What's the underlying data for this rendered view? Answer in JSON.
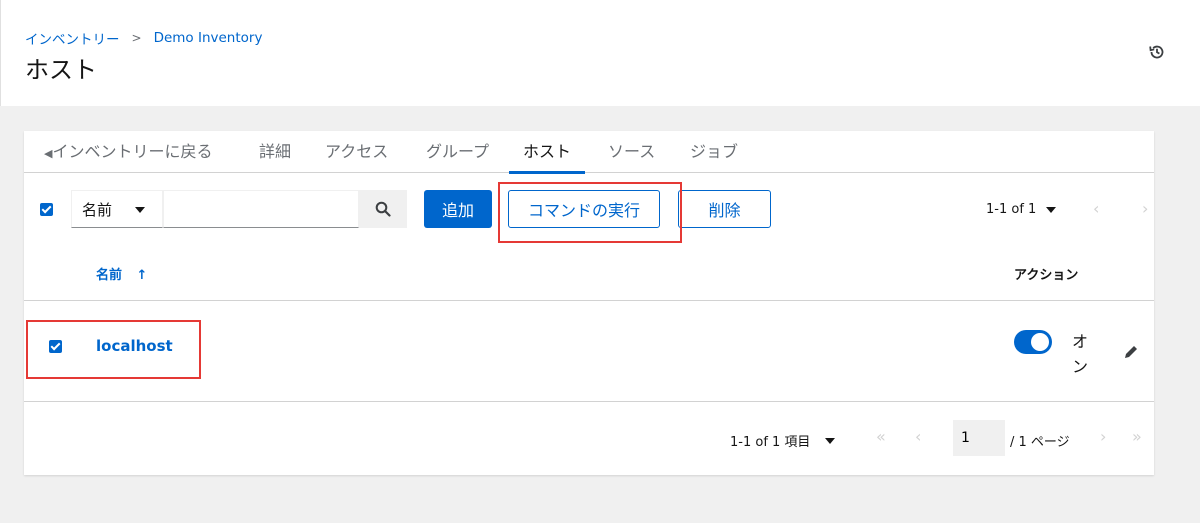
{
  "breadcrumb": {
    "parent": "インベントリー",
    "current": "Demo Inventory"
  },
  "page": {
    "title": "ホスト"
  },
  "tabs": [
    {
      "label": "インベントリーに戻る"
    },
    {
      "label": "詳細"
    },
    {
      "label": "アクセス"
    },
    {
      "label": "グループ"
    },
    {
      "label": "ホスト"
    },
    {
      "label": "ソース"
    },
    {
      "label": "ジョブ"
    }
  ],
  "toolbar": {
    "filter_label": "名前",
    "search_placeholder": "",
    "add_label": "追加",
    "run_command_label": "コマンドの実行",
    "delete_label": "削除",
    "pagination": "1-1 of 1"
  },
  "table": {
    "columns": {
      "name": "名前",
      "actions": "アクション"
    },
    "rows": [
      {
        "name": "localhost",
        "enabled_label": "オン",
        "selected": true,
        "enabled": true
      }
    ]
  },
  "footer": {
    "range": "1-1 of 1 項目",
    "page_value": "1",
    "page_total": "/ 1 ページ"
  },
  "colors": {
    "accent": "#0066cc",
    "highlight": "#e53935"
  }
}
